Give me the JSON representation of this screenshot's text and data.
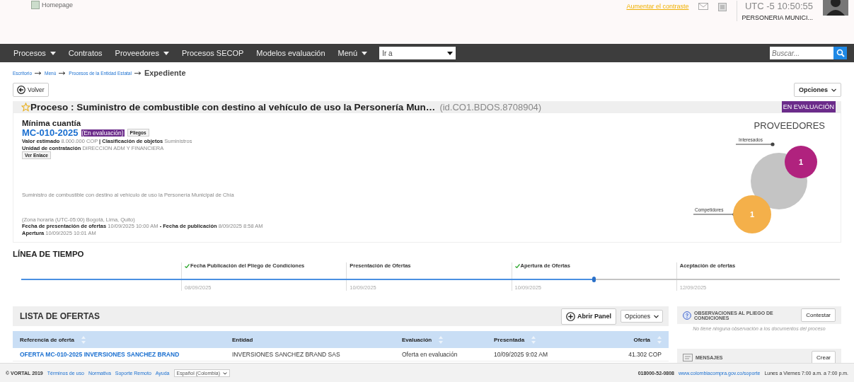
{
  "header": {
    "logo_alt": "Homepage",
    "contrast_link": "Aumentar el contraste",
    "clock": "UTC -5 10:50:55",
    "user": "PERSONERIA MUNICI..."
  },
  "nav": {
    "items": [
      {
        "label": "Procesos",
        "dropdown": true
      },
      {
        "label": "Contratos",
        "dropdown": false
      },
      {
        "label": "Proveedores",
        "dropdown": true
      },
      {
        "label": "Procesos SECOP",
        "dropdown": false
      },
      {
        "label": "Modelos evaluación",
        "dropdown": false
      },
      {
        "label": "Menú",
        "dropdown": true
      }
    ],
    "goto": {
      "value": "Ir a"
    },
    "search": {
      "placeholder": "Buscar..."
    }
  },
  "breadcrumb": {
    "items": [
      "Escritorio",
      "Menú",
      "Procesos de la Entidad Estatal"
    ],
    "current": "Expediente"
  },
  "back_button": "Volver",
  "options_button": "Opciones",
  "process": {
    "title": "Proceso : Suministro de combustible con destino al vehículo de uso la Personería Mun…",
    "id": "(id.CO1.BDOS.8708904)",
    "status": "EN EVALUACIÓN"
  },
  "detail": {
    "type": "Mínima cuantía",
    "code": "MC-010-2025",
    "code_status": "(En evaluación)",
    "pliegos_button": "Pliegos",
    "lines": [
      "**Valor estimado** 8.000.000 COP **| Clasificación de objetos**  Suministros",
      "**Unidad de contratación** DIRECCION ADM Y FINANCIERA"
    ],
    "link_button": "Ver Enlace",
    "description": "Suministro de combustible con destino al vehículo de uso la Personería Municipal de Chía",
    "timezone": "(Zona horaria (UTC-05:00) Bogotá, Lima, Quito)",
    "dates": [
      "**Fecha de presentación de ofertas** 10/09/2025 10:00 AM **- Fecha de publicación** 8/09/2025 8:58 AM",
      "**Apertura** 10/09/2025 10:01 AM"
    ]
  },
  "providers": {
    "title": "PROVEEDORES",
    "interested": {
      "label": "Interesados",
      "count": "1"
    },
    "competitors": {
      "label": "Competidores",
      "count": "1"
    }
  },
  "timeline": {
    "title": "LÍNEA DE TIEMPO",
    "level": 0.7,
    "stages": [
      {
        "label": "Fecha Publicación del Pliego de Condiciones",
        "date": "08/09/2025",
        "done": true
      },
      {
        "label": "Presentación de Ofertas",
        "date": "10/09/2025",
        "done": false
      },
      {
        "label": "Apertura de Ofertas",
        "date": "10/09/2025",
        "done": true
      },
      {
        "label": "Aceptación de ofertas",
        "date": "12/09/2025",
        "done": false
      }
    ]
  },
  "offers": {
    "title": "LISTA DE OFERTAS",
    "open_panel": "Abrir Panel",
    "options": "Opciones",
    "columns": [
      {
        "label": "Referencia de oferta",
        "sortable": true
      },
      {
        "label": "Entidad",
        "sortable": false
      },
      {
        "label": "Evaluación",
        "sortable": true
      },
      {
        "label": "Presentada",
        "sortable": true
      },
      {
        "label": "Oferta",
        "sortable": true
      }
    ],
    "rows": [
      {
        "reference": "OFERTA MC-010-2025 INVERSIONES SANCHEZ BRAND",
        "entity": "INVERSIONES SANCHEZ BRAND SAS",
        "evaluation": "Oferta en evaluación",
        "submitted": "10/09/2025 9:02 AM",
        "offer": "41.302 COP"
      }
    ]
  },
  "observations": {
    "title": "OBSERVACIONES AL PLIEGO DE CONDICIONES",
    "answer_button": "Contestar",
    "empty": "No tiene ninguna observación a los documentos del proceso"
  },
  "messages": {
    "title": "MENSAJES",
    "create_button": "Crear"
  },
  "footer": {
    "copyright": "© VORTAL 2019",
    "links": [
      "Términos de uso",
      "Normativa",
      "Soporte Remoto",
      "Ayuda"
    ],
    "language": "Español (Colombia)",
    "phone": "018000-52-0808",
    "url": "www.colombiacompra.gov.co/soporte",
    "hours": "Lunes a Viernes 7:00 a.m. a 7:00 p.m."
  }
}
